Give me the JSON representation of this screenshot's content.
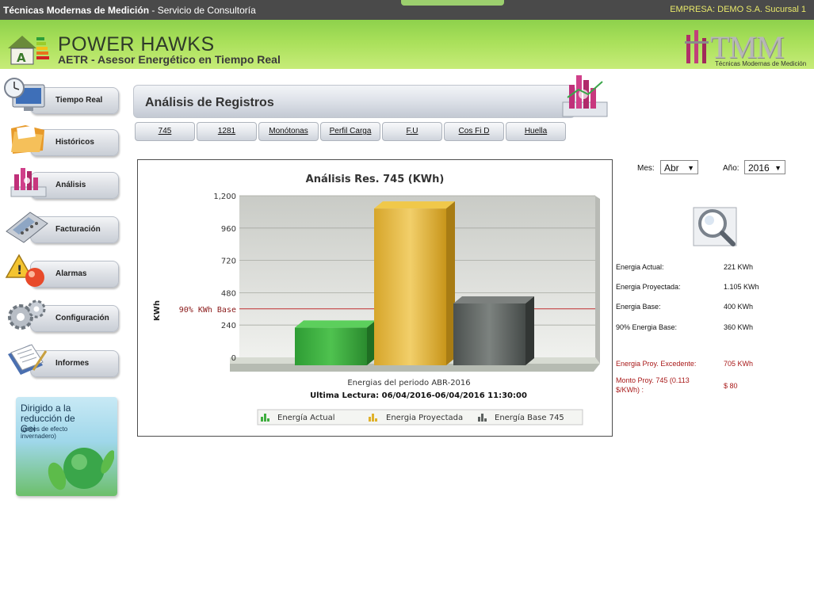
{
  "topbar": {
    "brand_bold": "Técnicas Modernas de Medición",
    "brand_rest": " - Servicio de Consultoría",
    "empresa": "EMPRESA: DEMO S.A. Sucursal 1"
  },
  "header": {
    "app_title": "POWER HAWKS",
    "app_subtitle": "AETR - Asesor Energético en Tiempo Real",
    "logo_letters": "TMM",
    "logo_caption": "Técnicas Modernas de Medición"
  },
  "sidebar": {
    "items": [
      {
        "label": "Tiempo Real",
        "icon": "monitor-clock-icon"
      },
      {
        "label": "Históricos",
        "icon": "folder-icon"
      },
      {
        "label": "Análisis",
        "icon": "bar-chart-icon"
      },
      {
        "label": "Facturación",
        "icon": "calculator-icon"
      },
      {
        "label": "Alarmas",
        "icon": "warning-icon"
      },
      {
        "label": "Configuración",
        "icon": "gears-icon"
      },
      {
        "label": "Informes",
        "icon": "documents-icon"
      }
    ],
    "gei_title": "Dirigido a la reducción de Gei",
    "gei_sub": "(gases de efecto invernadero)"
  },
  "page": {
    "title": "Análisis de Registros"
  },
  "tabs": [
    "745",
    "1281",
    "Monótonas",
    "Perfil Carga",
    "F.U",
    "Cos Fi D",
    "Huella"
  ],
  "controls": {
    "mes_label": "Mes:",
    "mes_value": "Abr",
    "anio_label": "Año:",
    "anio_value": "2016"
  },
  "info": {
    "energia_actual_label": "Energia Actual:",
    "energia_actual_value": "221 KWh",
    "energia_proyectada_label": "Energia Proyectada:",
    "energia_proyectada_value": "1.105 KWh",
    "energia_base_label": "Energia Base:",
    "energia_base_value": "400 KWh",
    "energia_base90_label": "90% Energia Base:",
    "energia_base90_value": "360 KWh",
    "excedente_label": "Energia Proy. Excedente:",
    "excedente_value": "705 KWh",
    "monto_label": "Monto Proy. 745 (0.113 $/KWh) :",
    "monto_value": "$ 80"
  },
  "colors": {
    "actual": "#3fae3f",
    "proyectada": "#e0b12a",
    "base": "#5c615f",
    "threshold": "#c03030"
  },
  "chart_data": {
    "type": "bar",
    "title": "Análisis Res. 745 (KWh)",
    "ylabel": "KWh",
    "xlabel": "Energias del periodo ABR-2016",
    "subtitle": "Ultima Lectura: 06/04/2016-06/04/2016 11:30:00",
    "ylim": [
      0,
      1200
    ],
    "yticks": [
      "1,200",
      "960",
      "720",
      "480",
      "240",
      "0"
    ],
    "series": [
      {
        "name": "Energía Actual",
        "values": [
          221
        ]
      },
      {
        "name": "Energia Proyectada",
        "values": [
          1105
        ]
      },
      {
        "name": "Energía Base 745",
        "values": [
          400
        ]
      }
    ],
    "threshold": {
      "label": "90% KWh Base",
      "value": 360
    },
    "grid": true,
    "legend": "bottom"
  }
}
